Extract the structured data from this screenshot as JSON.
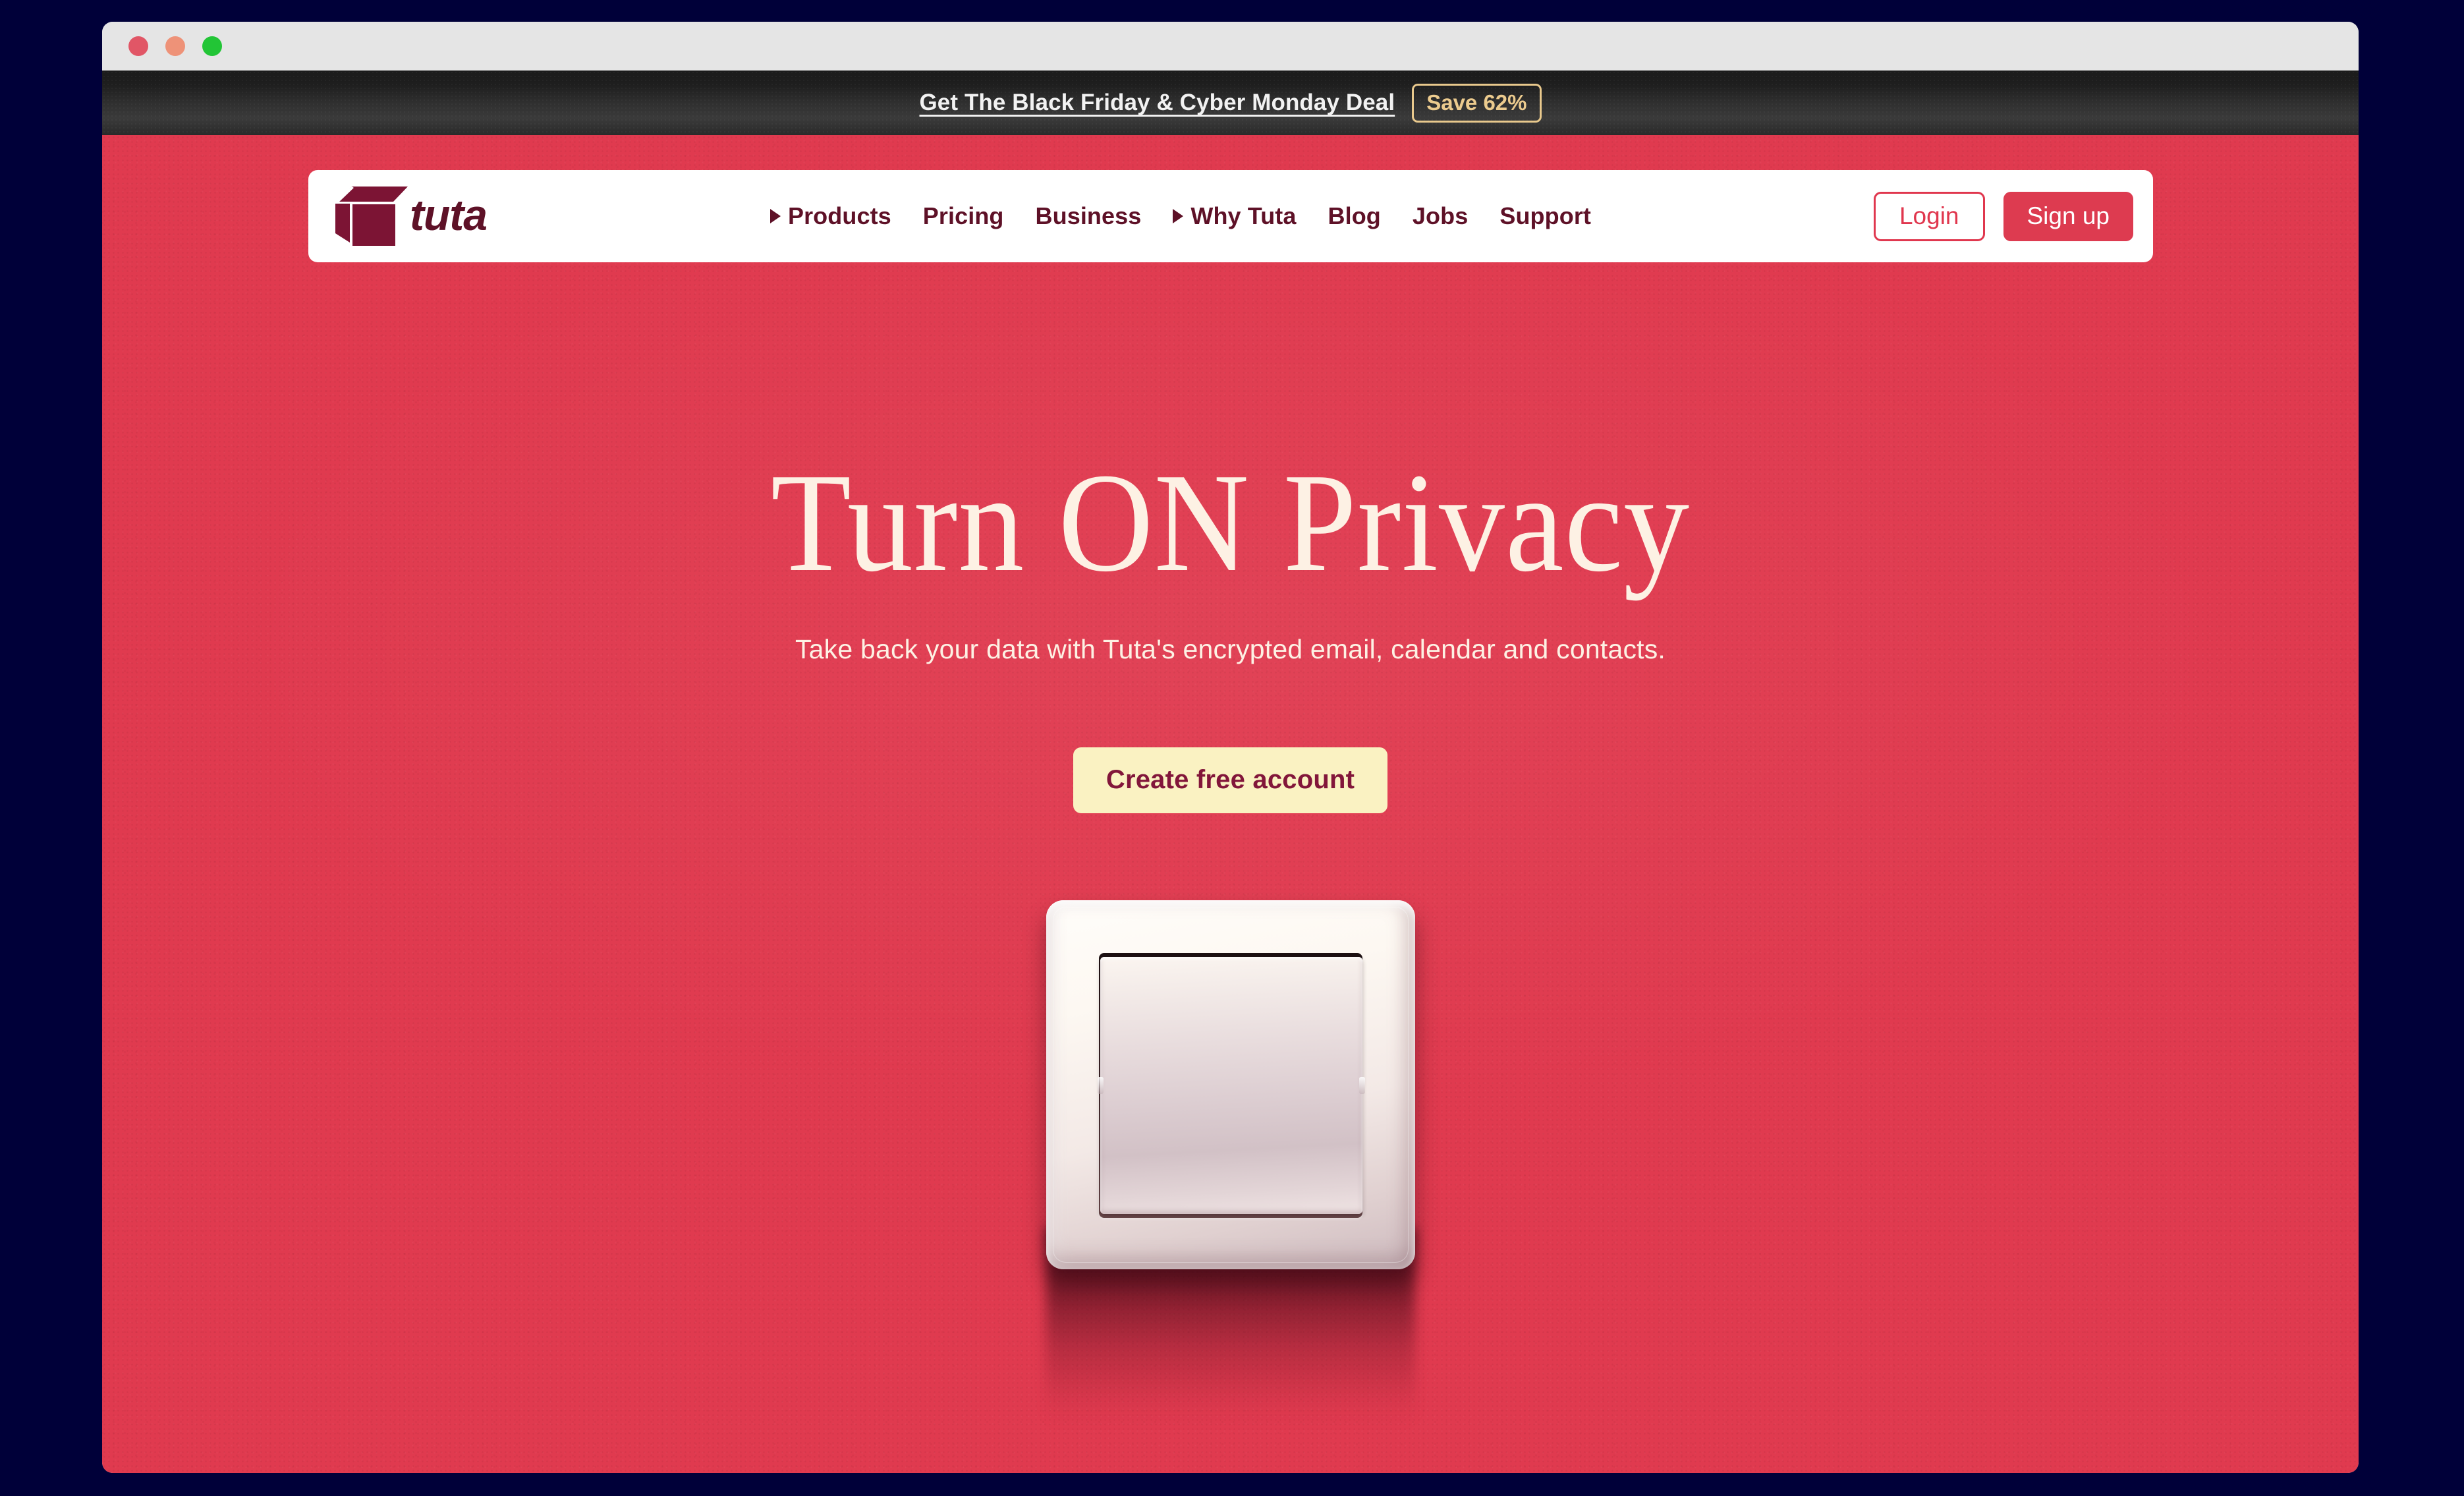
{
  "window": {
    "traffic_lights": [
      {
        "name": "close",
        "color": "#e15666"
      },
      {
        "name": "minimize",
        "color": "#ee9278"
      },
      {
        "name": "maximize",
        "color": "#22c536"
      }
    ]
  },
  "promo": {
    "link_text": "Get The Black Friday & Cyber Monday Deal",
    "badge_text": "Save 62%",
    "badge_color": "#e9c98d",
    "background": "#1e1e1e"
  },
  "nav": {
    "logo_text": "tuta",
    "logo_icon": "tuta-box-logo-icon",
    "items": [
      {
        "label": "Products",
        "has_caret": true
      },
      {
        "label": "Pricing",
        "has_caret": false
      },
      {
        "label": "Business",
        "has_caret": false
      },
      {
        "label": "Why Tuta",
        "has_caret": true
      },
      {
        "label": "Blog",
        "has_caret": false
      },
      {
        "label": "Jobs",
        "has_caret": false
      },
      {
        "label": "Support",
        "has_caret": false
      }
    ],
    "login_label": "Login",
    "signup_label": "Sign up",
    "accent_color": "#e0374e",
    "text_color": "#5e1127"
  },
  "hero": {
    "title": "Turn ON Privacy",
    "subtitle": "Take back your data with Tuta's encrypted email, calendar and contacts.",
    "cta_label": "Create free account",
    "background_color": "#e03a4f",
    "title_color": "#fdf1e4",
    "cta_background": "#faf2c2",
    "cta_text_color": "#82163a",
    "image_name": "light-switch-photo"
  }
}
